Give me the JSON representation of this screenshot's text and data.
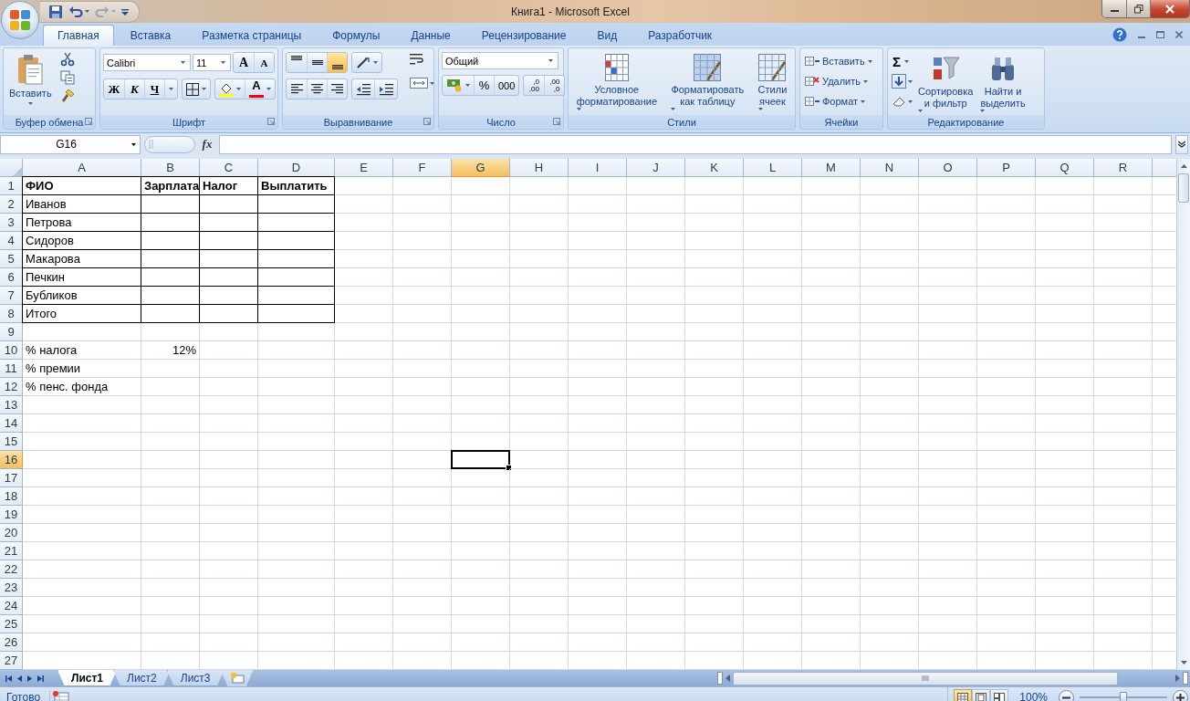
{
  "window": {
    "title": "Книга1 - Microsoft Excel"
  },
  "tabs": [
    {
      "label": "Главная",
      "selected": true
    },
    {
      "label": "Вставка",
      "selected": false
    },
    {
      "label": "Разметка страницы",
      "selected": false
    },
    {
      "label": "Формулы",
      "selected": false
    },
    {
      "label": "Данные",
      "selected": false
    },
    {
      "label": "Рецензирование",
      "selected": false
    },
    {
      "label": "Вид",
      "selected": false
    },
    {
      "label": "Разработчик",
      "selected": false
    }
  ],
  "ribbon": {
    "clipboard": {
      "label": "Буфер обмена",
      "paste": "Вставить"
    },
    "font": {
      "label": "Шрифт",
      "font_name": "Calibri",
      "font_size": "11",
      "grow": "A",
      "shrink": "A",
      "bold": "Ж",
      "italic": "К",
      "underline": "Ч",
      "font_color": "A"
    },
    "alignment": {
      "label": "Выравнивание",
      "vertical": [
        {
          "selected": false
        },
        {
          "selected": false
        },
        {
          "selected": true
        }
      ]
    },
    "number": {
      "label": "Число",
      "format": "Общий",
      "percent": "%",
      "thousands": "000",
      "increase_decimal": [
        ",0",
        ",00"
      ],
      "decrease_decimal": [
        ",00",
        ",0"
      ]
    },
    "styles": {
      "label": "Стили",
      "buttons": [
        {
          "label": "Условное\nформатирование"
        },
        {
          "label": "Форматировать\nкак таблицу"
        },
        {
          "label": "Стили\nячеек"
        }
      ]
    },
    "cells": {
      "label": "Ячейки",
      "buttons": [
        "Вставить",
        "Удалить",
        "Формат"
      ]
    },
    "editing": {
      "label": "Редактирование",
      "sum": "Σ",
      "buttons": [
        "Сортировка\nи фильтр",
        "Найти и\nвыделить"
      ]
    }
  },
  "formula_bar": {
    "name_box": "G16",
    "fx": "fx"
  },
  "sheet": {
    "columns": [
      {
        "label": "A",
        "selected": false
      },
      {
        "label": "B",
        "selected": false
      },
      {
        "label": "C",
        "selected": false
      },
      {
        "label": "D",
        "selected": false
      },
      {
        "label": "E",
        "selected": false
      },
      {
        "label": "F",
        "selected": false
      },
      {
        "label": "G",
        "selected": true
      },
      {
        "label": "H",
        "selected": false
      },
      {
        "label": "I",
        "selected": false
      },
      {
        "label": "J",
        "selected": false
      },
      {
        "label": "K",
        "selected": false
      },
      {
        "label": "L",
        "selected": false
      },
      {
        "label": "M",
        "selected": false
      },
      {
        "label": "N",
        "selected": false
      },
      {
        "label": "O",
        "selected": false
      },
      {
        "label": "P",
        "selected": false
      },
      {
        "label": "Q",
        "selected": false
      },
      {
        "label": "R",
        "selected": false
      }
    ],
    "rows": [
      {
        "label": "1",
        "selected": false,
        "bordered": true,
        "cells": [
          {
            "text": "ФИО",
            "kind": "text",
            "bold": true
          },
          {
            "text": "Зарплата",
            "kind": "text",
            "bold": true
          },
          {
            "text": "Налог",
            "kind": "text",
            "bold": true
          },
          {
            "text": "Выплатить",
            "kind": "text",
            "bold": true
          }
        ]
      },
      {
        "label": "2",
        "selected": false,
        "bordered": true,
        "cells": [
          {
            "text": "Иванов",
            "kind": "text",
            "bold": false
          }
        ]
      },
      {
        "label": "3",
        "selected": false,
        "bordered": true,
        "cells": [
          {
            "text": "Петрова",
            "kind": "text",
            "bold": false
          }
        ]
      },
      {
        "label": "4",
        "selected": false,
        "bordered": true,
        "cells": [
          {
            "text": "Сидоров",
            "kind": "text",
            "bold": false
          }
        ]
      },
      {
        "label": "5",
        "selected": false,
        "bordered": true,
        "cells": [
          {
            "text": "Макарова",
            "kind": "text",
            "bold": false
          }
        ]
      },
      {
        "label": "6",
        "selected": false,
        "bordered": true,
        "cells": [
          {
            "text": "Печкин",
            "kind": "text",
            "bold": false
          }
        ]
      },
      {
        "label": "7",
        "selected": false,
        "bordered": true,
        "cells": [
          {
            "text": "Бубликов",
            "kind": "text",
            "bold": false
          }
        ]
      },
      {
        "label": "8",
        "selected": false,
        "bordered": true,
        "cells": [
          {
            "text": "Итого",
            "kind": "text",
            "bold": false
          }
        ]
      },
      {
        "label": "9",
        "selected": false,
        "bordered": false
      },
      {
        "label": "10",
        "selected": false,
        "bordered": false,
        "cells": [
          {
            "text": "% налога",
            "kind": "text",
            "bold": false
          },
          {
            "text": "12%",
            "kind": "number",
            "bold": false
          }
        ]
      },
      {
        "label": "11",
        "selected": false,
        "bordered": false,
        "cells": [
          {
            "text": "% премии",
            "kind": "text",
            "bold": false
          }
        ]
      },
      {
        "label": "12",
        "selected": false,
        "bordered": false,
        "cells": [
          {
            "text": "% пенс. фонда",
            "kind": "text",
            "bold": false
          }
        ]
      },
      {
        "label": "13",
        "selected": false,
        "bordered": false
      },
      {
        "label": "14",
        "selected": false,
        "bordered": false
      },
      {
        "label": "15",
        "selected": false,
        "bordered": false
      },
      {
        "label": "16",
        "selected": true,
        "bordered": false
      },
      {
        "label": "17",
        "selected": false,
        "bordered": false
      },
      {
        "label": "18",
        "selected": false,
        "bordered": false
      },
      {
        "label": "19",
        "selected": false,
        "bordered": false
      },
      {
        "label": "20",
        "selected": false,
        "bordered": false
      },
      {
        "label": "21",
        "selected": false,
        "bordered": false
      },
      {
        "label": "22",
        "selected": false,
        "bordered": false
      },
      {
        "label": "23",
        "selected": false,
        "bordered": false
      },
      {
        "label": "24",
        "selected": false,
        "bordered": false
      },
      {
        "label": "25",
        "selected": false,
        "bordered": false
      },
      {
        "label": "26",
        "selected": false,
        "bordered": false
      },
      {
        "label": "27",
        "selected": false,
        "bordered": false
      }
    ]
  },
  "sheet_tabs": [
    {
      "label": "Лист1",
      "selected": true
    },
    {
      "label": "Лист2",
      "selected": false
    },
    {
      "label": "Лист3",
      "selected": false
    }
  ],
  "status_bar": {
    "status": "Готово",
    "views": [
      {
        "selected": true
      },
      {
        "selected": false
      },
      {
        "selected": false
      }
    ],
    "zoom": "100%",
    "zoom_slider": {
      "level": 0.5
    }
  }
}
